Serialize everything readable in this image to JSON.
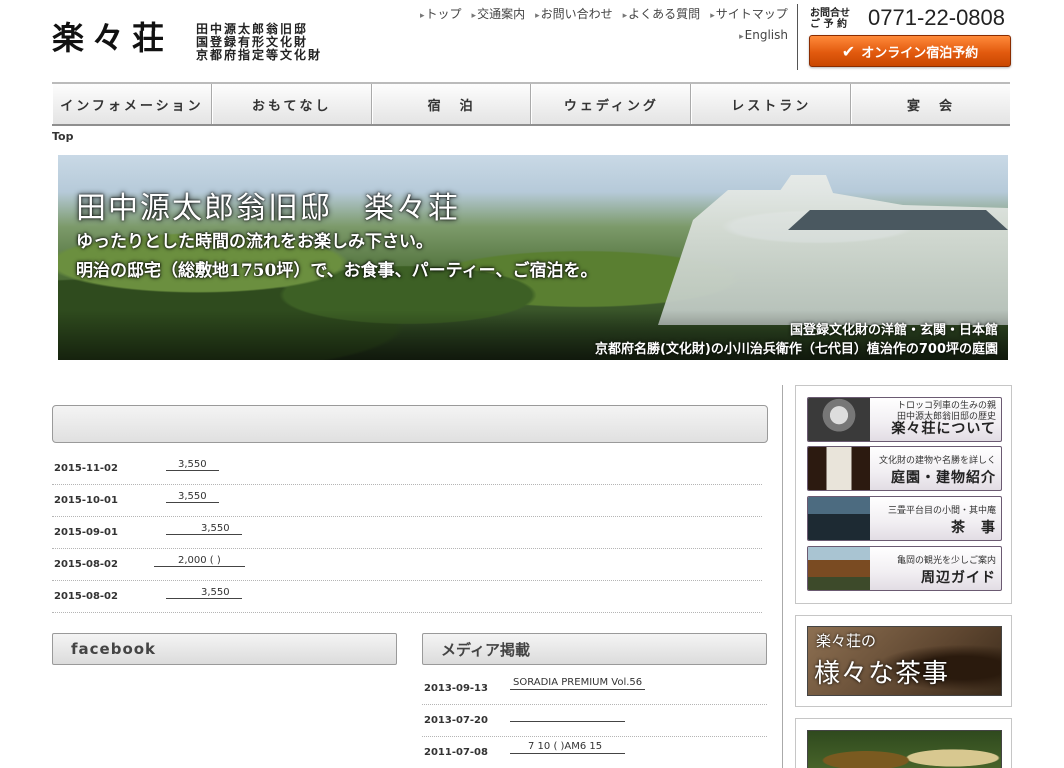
{
  "header": {
    "logo": "楽々荘",
    "subtitle_lines": [
      "田中源太郎翁旧邸",
      "国登録有形文化財",
      "京都府指定等文化財"
    ],
    "util_links": [
      "トップ",
      "交通案内",
      "お問い合わせ",
      "よくある質問",
      "サイトマップ"
    ],
    "english_link": "English",
    "contact_label_line1": "お問合せ",
    "contact_label_line2": "ご 予 約",
    "phone": "0771-22-0808",
    "reserve_button": "オンライン宿泊予約"
  },
  "gnav": [
    "インフォメーション",
    "おもてなし",
    "宿　泊",
    "ウェディング",
    "レストラン",
    "宴　会"
  ],
  "breadcrumb": "Top",
  "hero": {
    "title": "田中源太郎翁旧邸　楽々荘",
    "line1": "ゆったりとした時間の流れをお楽しみ下さい。",
    "line2": "明治の邸宅（総敷地1750坪）で、お食事、パーティー、ご宿泊を。",
    "caption1": "国登録文化財の洋館・玄関・日本館",
    "caption2": "京都府名勝(文化財)の小川治兵衛作（七代目）植治作の700坪の庭園"
  },
  "news": [
    {
      "date": "2015-11-02",
      "text": "3,550"
    },
    {
      "date": "2015-10-01",
      "text": "3,550"
    },
    {
      "date": "2015-09-01",
      "text": "3,550"
    },
    {
      "date": "2015-08-02",
      "text": "2,000 (  )"
    },
    {
      "date": "2015-08-02",
      "text": "3,550"
    }
  ],
  "facebook_heading": "facebook",
  "media_heading": "メディア掲載",
  "media": [
    {
      "date": "2013-09-13",
      "text": "SORADIA PREMIUM Vol.56"
    },
    {
      "date": "2013-07-20",
      "text": ""
    },
    {
      "date": "2011-07-08",
      "text": "7 10 ( )AM6 15"
    }
  ],
  "sidebar": {
    "buttons": [
      {
        "small": [
          "トロッコ列車の生みの親",
          "田中源太郎翁旧邸の歴史"
        ],
        "big": "楽々荘について",
        "icon": "portrait-photo"
      },
      {
        "small": [
          "文化財の建物や名勝を詳しく"
        ],
        "big": "庭園・建物紹介",
        "icon": "signboard-photo"
      },
      {
        "small": [
          "三畳平台目の小間・其中庵"
        ],
        "big": "茶　事",
        "icon": "tearoom-photo"
      },
      {
        "small": [
          "亀岡の観光を少しご案内"
        ],
        "big": "周辺ガイド",
        "icon": "shrine-photo"
      }
    ],
    "tea_banner_small": "楽々荘の",
    "tea_banner_big": "様々な茶事"
  },
  "colors": {
    "reserve_orange": "#e25a0e",
    "nav_bg": "#eeeeee",
    "side_border": "#6b5a72"
  }
}
